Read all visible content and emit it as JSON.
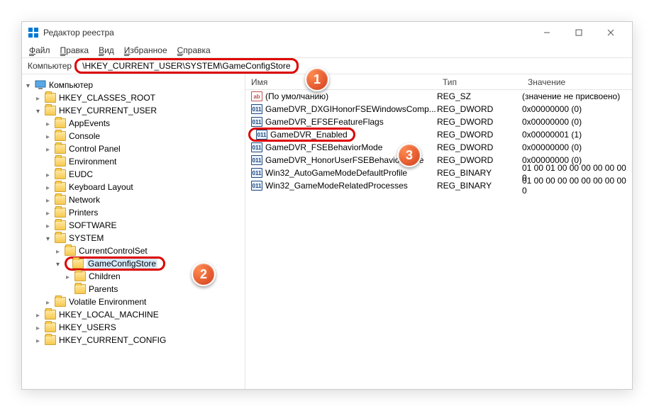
{
  "window": {
    "title": "Редактор реестра"
  },
  "winbuttons": {
    "min": "—",
    "max": "□",
    "close": "✕"
  },
  "menu": {
    "file": "Файл",
    "edit": "Правка",
    "view": "Вид",
    "fav": "Избранное",
    "help": "Справка"
  },
  "address": {
    "label": "Компьютер",
    "path": "\\HKEY_CURRENT_USER\\SYSTEM\\GameConfigStore"
  },
  "tree": {
    "root": "Компьютер",
    "n0": "HKEY_CLASSES_ROOT",
    "n1": "HKEY_CURRENT_USER",
    "n1c": {
      "a": "AppEvents",
      "b": "Console",
      "c": "Control Panel",
      "d": "Environment",
      "e": "EUDC",
      "f": "Keyboard Layout",
      "g": "Network",
      "h": "Printers",
      "i": "SOFTWARE",
      "j": "SYSTEM",
      "jc": {
        "a": "CurrentControlSet",
        "b": "GameConfigStore",
        "bc": {
          "a": "Children",
          "b": "Parents"
        }
      },
      "k": "Volatile Environment"
    },
    "n2": "HKEY_LOCAL_MACHINE",
    "n3": "HKEY_USERS",
    "n4": "HKEY_CURRENT_CONFIG"
  },
  "list": {
    "hdr": {
      "name": "Имя",
      "type": "Тип",
      "value": "Значение"
    },
    "rows": [
      {
        "name": "(По умолчанию)",
        "icon": "sz",
        "type": "REG_SZ",
        "value": "(значение не присвоено)"
      },
      {
        "name": "GameDVR_DXGIHonorFSEWindowsComp...",
        "icon": "dw",
        "type": "REG_DWORD",
        "value": "0x00000000 (0)"
      },
      {
        "name": "GameDVR_EFSEFeatureFlags",
        "icon": "dw",
        "type": "REG_DWORD",
        "value": "0x00000000 (0)"
      },
      {
        "name": "GameDVR_Enabled",
        "icon": "dw",
        "type": "REG_DWORD",
        "value": "0x00000001 (1)"
      },
      {
        "name": "GameDVR_FSEBehaviorMode",
        "icon": "dw",
        "type": "REG_DWORD",
        "value": "0x00000000 (0)"
      },
      {
        "name": "GameDVR_HonorUserFSEBehaviorMode",
        "icon": "dw",
        "type": "REG_DWORD",
        "value": "0x00000000 (0)"
      },
      {
        "name": "Win32_AutoGameModeDefaultProfile",
        "icon": "dw",
        "type": "REG_BINARY",
        "value": "01 00 01 00 00 00 00 00 00 0"
      },
      {
        "name": "Win32_GameModeRelatedProcesses",
        "icon": "dw",
        "type": "REG_BINARY",
        "value": "01 00 00 00 00 00 00 00 00 0"
      }
    ]
  },
  "callouts": {
    "one": "1",
    "two": "2",
    "three": "3"
  }
}
